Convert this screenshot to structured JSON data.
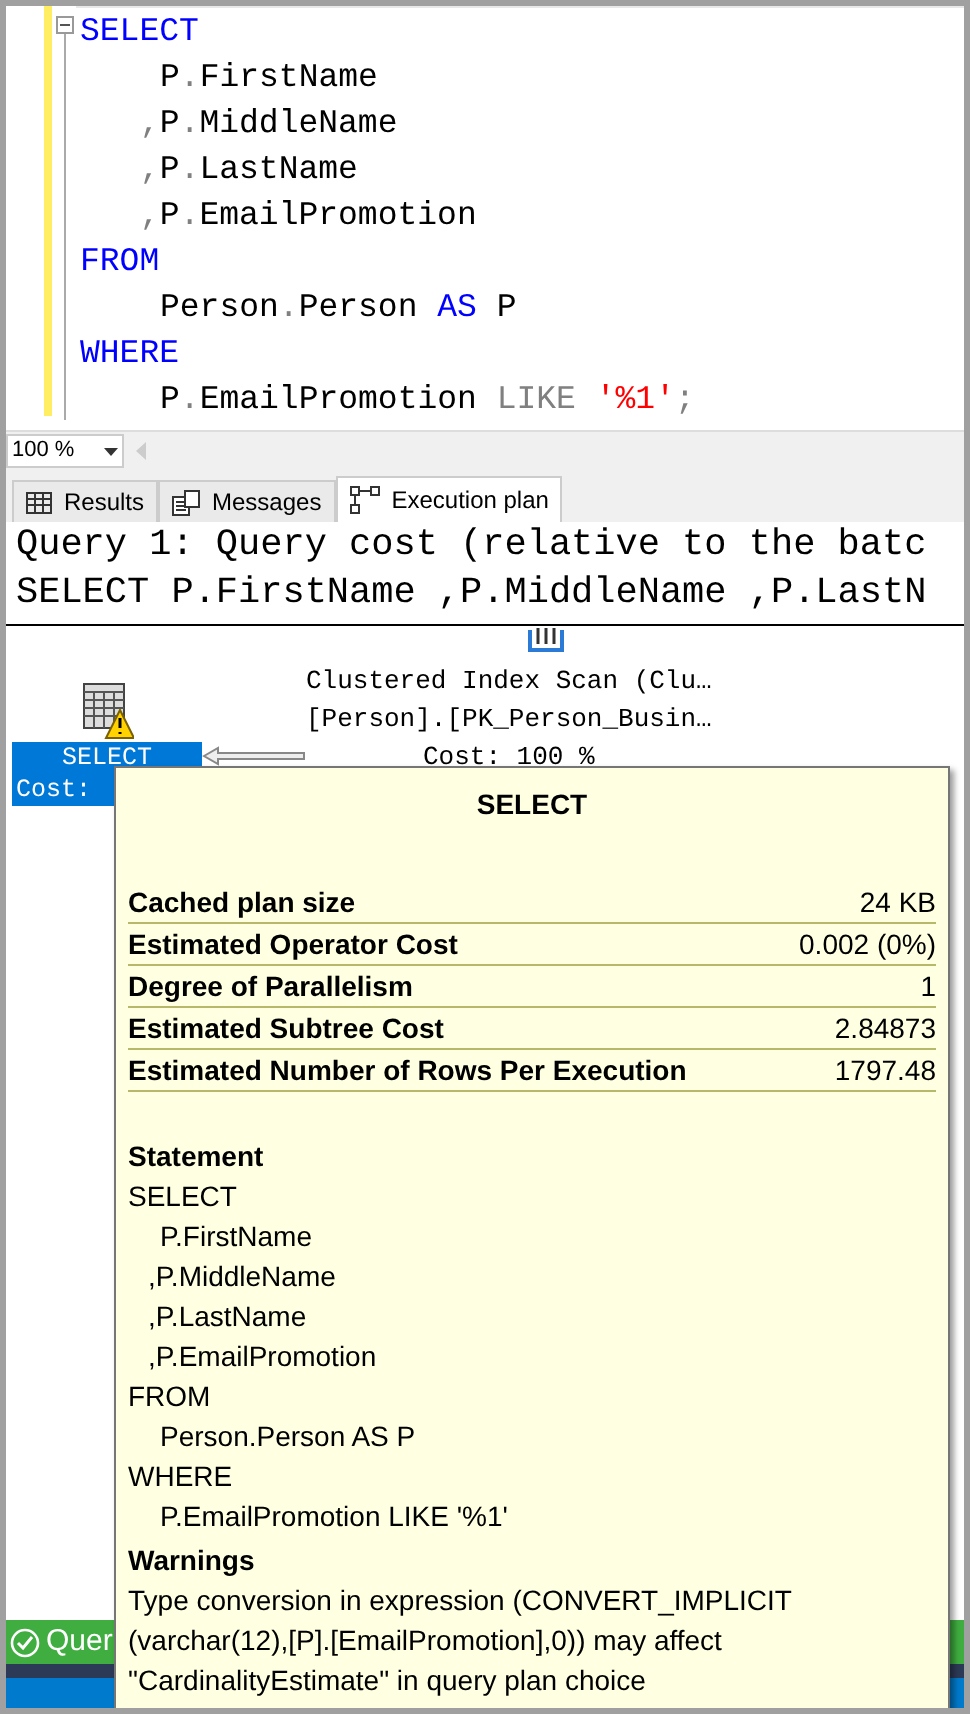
{
  "editor": {
    "lines": [
      {
        "tokens": [
          {
            "text": "SELECT",
            "kind": "keyword"
          }
        ],
        "children": [
          {
            "tokens": [
              {
                "text": "P",
                "kind": "plain"
              },
              {
                "text": ".",
                "kind": "punct"
              },
              {
                "text": "FirstName",
                "kind": "plain"
              }
            ]
          },
          {
            "tokens": [
              {
                "text": ",",
                "kind": "punct"
              },
              {
                "text": "P",
                "kind": "plain"
              },
              {
                "text": ".",
                "kind": "punct"
              },
              {
                "text": "MiddleName",
                "kind": "plain"
              }
            ]
          },
          {
            "tokens": [
              {
                "text": ",",
                "kind": "punct"
              },
              {
                "text": "P",
                "kind": "plain"
              },
              {
                "text": ".",
                "kind": "punct"
              },
              {
                "text": "LastName",
                "kind": "plain"
              }
            ]
          },
          {
            "tokens": [
              {
                "text": ",",
                "kind": "punct"
              },
              {
                "text": "P",
                "kind": "plain"
              },
              {
                "text": ".",
                "kind": "punct"
              },
              {
                "text": "EmailPromotion",
                "kind": "plain"
              }
            ]
          }
        ]
      },
      {
        "tokens": [
          {
            "text": "FROM",
            "kind": "keyword"
          }
        ],
        "children": [
          {
            "tokens": [
              {
                "text": "Person",
                "kind": "plain"
              },
              {
                "text": ".",
                "kind": "punct"
              },
              {
                "text": "Person ",
                "kind": "plain"
              },
              {
                "text": "AS",
                "kind": "keyword"
              },
              {
                "text": " P",
                "kind": "plain"
              }
            ]
          }
        ]
      },
      {
        "tokens": [
          {
            "text": "WHERE",
            "kind": "keyword"
          }
        ],
        "children": [
          {
            "tokens": [
              {
                "text": "P",
                "kind": "plain"
              },
              {
                "text": ".",
                "kind": "punct"
              },
              {
                "text": "EmailPromotion ",
                "kind": "plain"
              },
              {
                "text": "LIKE ",
                "kind": "operator"
              },
              {
                "text": "'%1'",
                "kind": "string"
              },
              {
                "text": ";",
                "kind": "punct"
              }
            ]
          }
        ]
      }
    ]
  },
  "zoom": "100 %",
  "tabs": [
    {
      "label": "Results",
      "kind": "grid",
      "selected": false
    },
    {
      "label": "Messages",
      "kind": "messages",
      "selected": false
    },
    {
      "label": "Execution plan",
      "kind": "plan",
      "selected": true
    }
  ],
  "plan": {
    "header": [
      "Query 1: Query cost (relative to the batc",
      "SELECT P.FirstName ,P.MiddleName ,P.LastN"
    ],
    "select_node": {
      "label": "SELECT",
      "cost": "Cost:"
    },
    "scan_node": {
      "lines": [
        "Clustered Index Scan (Clu…",
        "[Person].[PK_Person_Busin…"
      ],
      "cost": "Cost: 100 %"
    }
  },
  "tooltip": {
    "title": "SELECT",
    "rows": [
      {
        "label": "Cached plan size",
        "value": "24 KB"
      },
      {
        "label": "Estimated Operator Cost",
        "value": "0.002 (0%)"
      },
      {
        "label": "Degree of Parallelism",
        "value": "1"
      },
      {
        "label": "Estimated Subtree Cost",
        "value": "2.84873"
      },
      {
        "label": "Estimated Number of Rows Per Execution",
        "value": "1797.48"
      }
    ],
    "statement_heading": "Statement",
    "statement": [
      {
        "text": "SELECT",
        "children": [
          {
            "text": "P.FirstName"
          },
          {
            "text": ",P.MiddleName",
            "kind": "comma"
          },
          {
            "text": ",P.LastName",
            "kind": "comma"
          },
          {
            "text": ",P.EmailPromotion",
            "kind": "comma"
          }
        ]
      },
      {
        "text": "FROM",
        "children": [
          {
            "text": "Person.Person AS P"
          }
        ]
      },
      {
        "text": "WHERE",
        "children": [
          {
            "text": "P.EmailPromotion LIKE '%1'"
          }
        ]
      }
    ],
    "warnings_heading": "Warnings",
    "warning": "Type conversion in expression (CONVERT_IMPLICIT (varchar(12),[P].[EmailPromotion],0)) may affect \"CardinalityEstimate\" in query plan choice"
  },
  "status_bar": {
    "text": "Quer"
  }
}
